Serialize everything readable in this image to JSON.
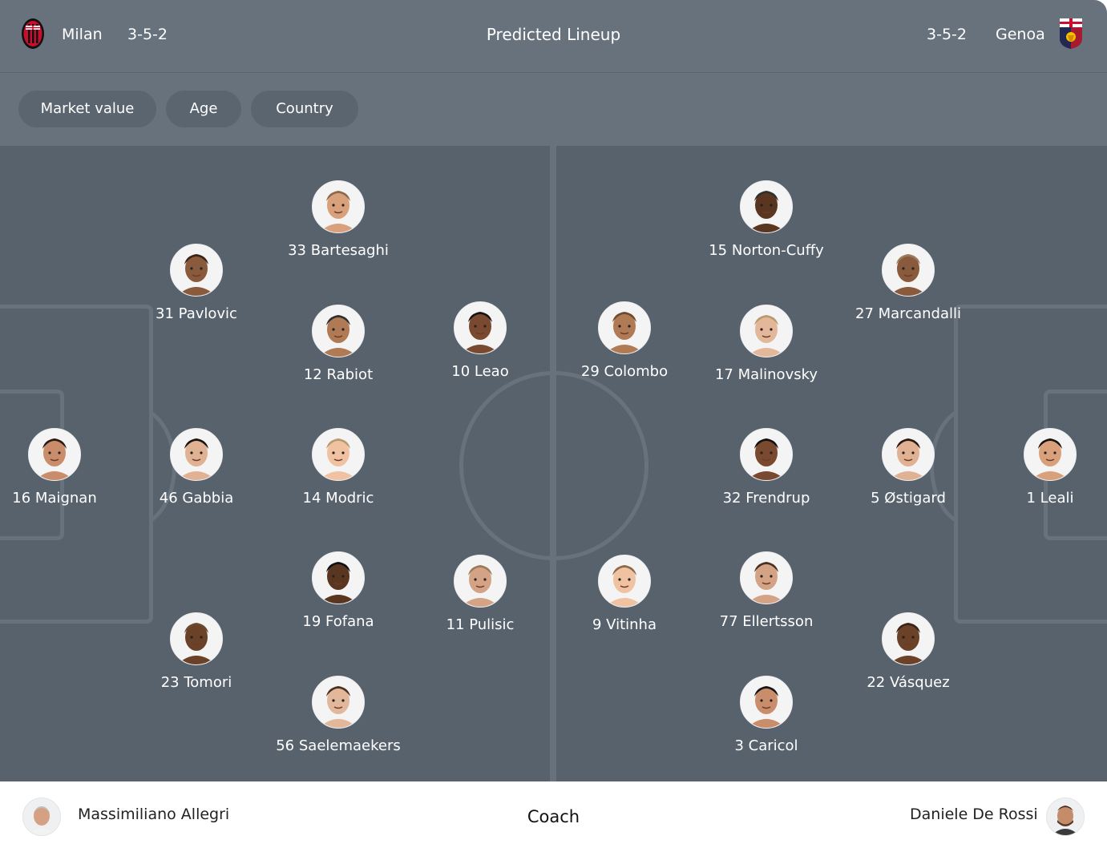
{
  "header": {
    "home_team": "Milan",
    "home_formation": "3-5-2",
    "title": "Predicted Lineup",
    "away_formation": "3-5-2",
    "away_team": "Genoa",
    "home_crest_icon": "milan-crest-icon",
    "away_crest_icon": "genoa-crest-icon"
  },
  "filters": [
    "Market value",
    "Age",
    "Country"
  ],
  "colors": {
    "header_bg": "#68727d",
    "pitch_bg": "#58626d",
    "pill_bg": "#5b6570",
    "pitch_lines": "#68727d",
    "text_light": "#ffffff"
  },
  "home_players": [
    {
      "label": "16 Maignan"
    },
    {
      "label": "31 Pavlovic"
    },
    {
      "label": "46 Gabbia"
    },
    {
      "label": "23 Tomori"
    },
    {
      "label": "33 Bartesaghi"
    },
    {
      "label": "12 Rabiot"
    },
    {
      "label": "14 Modric"
    },
    {
      "label": "19 Fofana"
    },
    {
      "label": "56 Saelemaekers"
    },
    {
      "label": "10 Leao"
    },
    {
      "label": "11 Pulisic"
    }
  ],
  "away_players": [
    {
      "label": "29 Colombo"
    },
    {
      "label": "9 Vitinha"
    },
    {
      "label": "15 Norton-Cuffy"
    },
    {
      "label": "17 Malinovsky"
    },
    {
      "label": "32 Frendrup"
    },
    {
      "label": "77 Ellertsson"
    },
    {
      "label": "3 Caricol"
    },
    {
      "label": "27 Marcandalli"
    },
    {
      "label": "5 Østigard"
    },
    {
      "label": "22 Vásquez"
    },
    {
      "label": "1 Leali"
    }
  ],
  "coaches": {
    "home": "Massimiliano Allegri",
    "title": "Coach",
    "away": "Daniele De Rossi"
  }
}
